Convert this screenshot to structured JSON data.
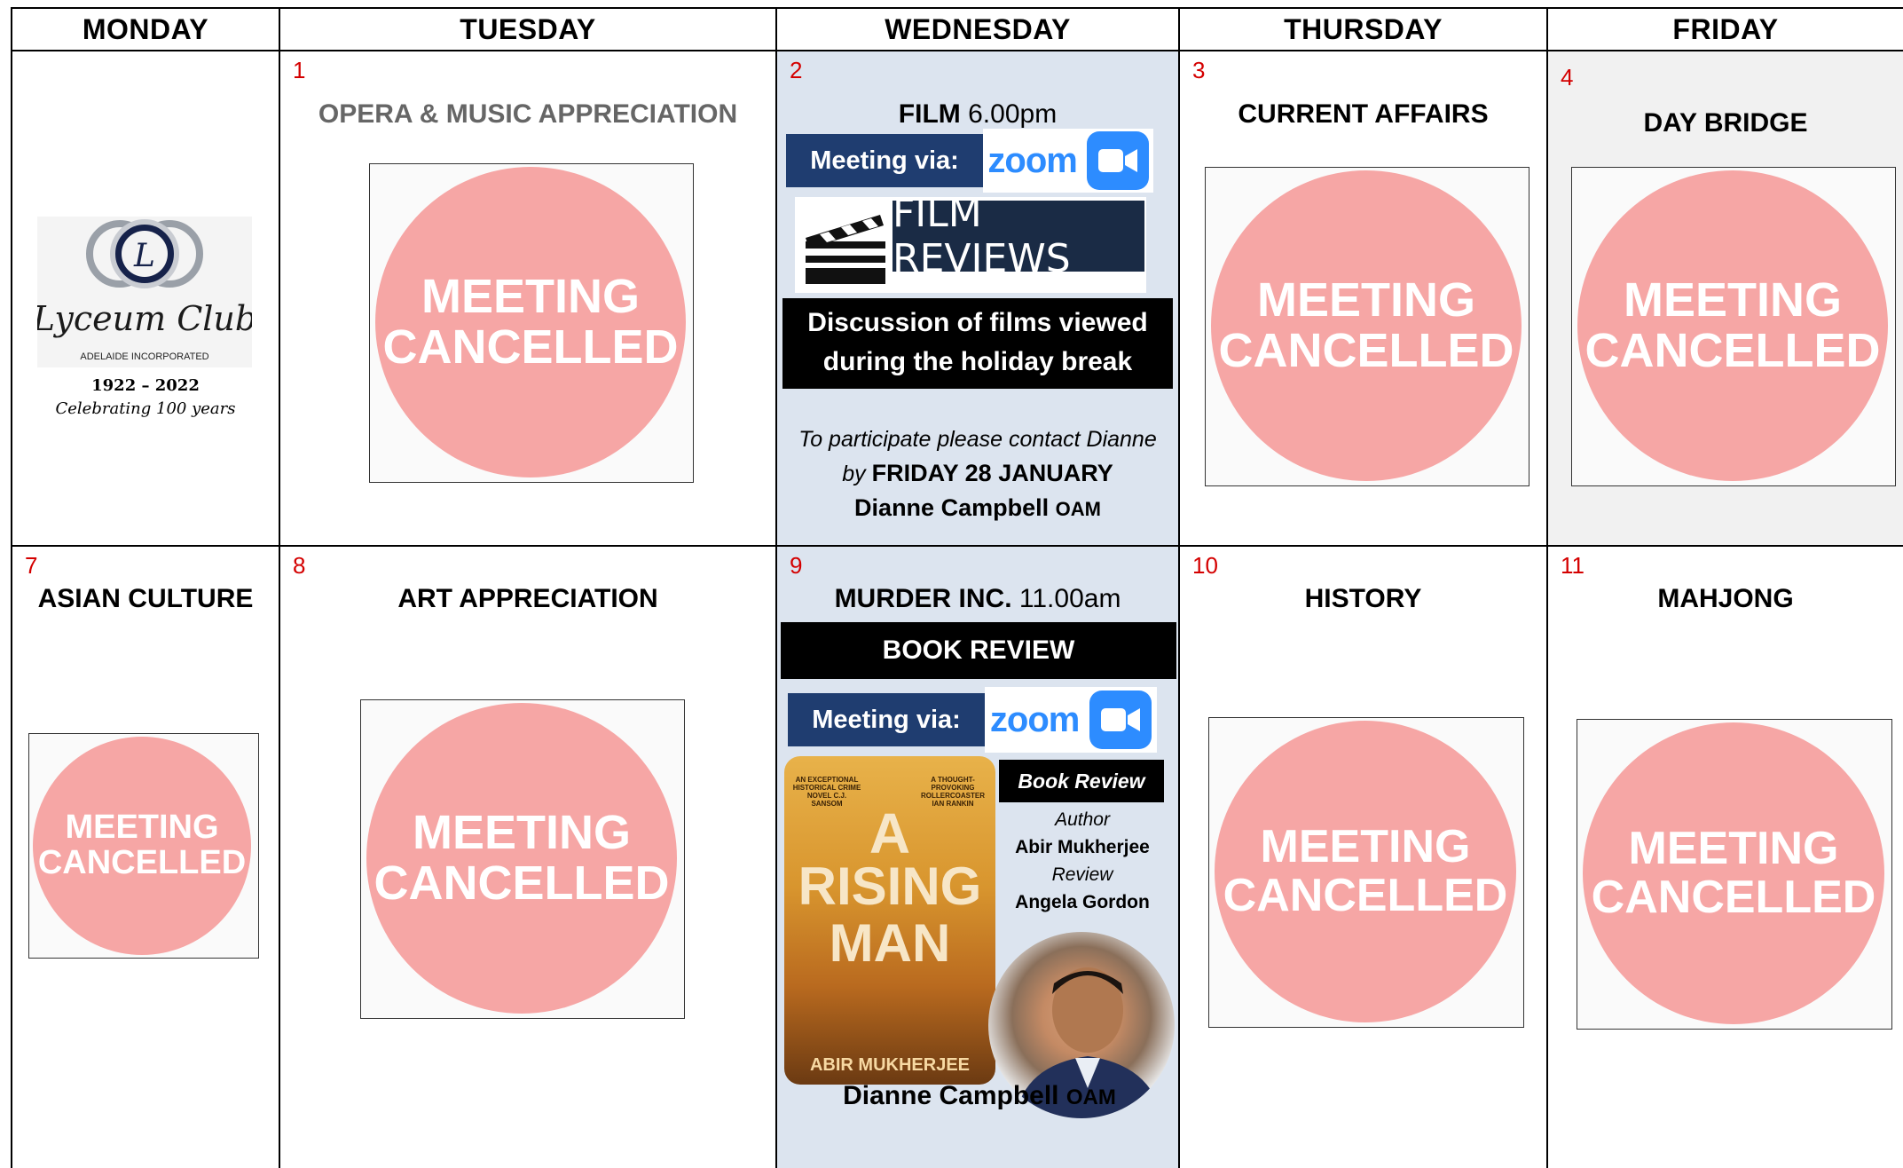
{
  "days": [
    "MONDAY",
    "TUESDAY",
    "WEDNESDAY",
    "THURSDAY",
    "FRIDAY"
  ],
  "cancel": {
    "line1": "MEETING",
    "line2": "CANCELLED"
  },
  "logo": {
    "name": "Lyceum Club",
    "initial": "L",
    "sub": "ADELAIDE INCORPORATED",
    "years": "1922 – 2022",
    "tagline": "Celebrating 100 years"
  },
  "week1": {
    "tue": {
      "num": "1",
      "title": "OPERA & MUSIC APPRECIATION"
    },
    "wed": {
      "num": "2",
      "title": "FILM",
      "time": "6.00pm",
      "meeting_via": "Meeting via:",
      "zoom": "zoom",
      "banner": "FILM REVIEWS",
      "discussion_1": "Discussion of films viewed",
      "discussion_2": "during the holiday break",
      "note_1": "To participate please contact Dianne",
      "note_by": "by",
      "note_date": "FRIDAY 28 JANUARY",
      "contact": "Dianne Campbell",
      "contact_suffix": "OAM"
    },
    "thu": {
      "num": "3",
      "title": "CURRENT AFFAIRS"
    },
    "fri": {
      "num": "4",
      "title": "DAY BRIDGE"
    }
  },
  "week2": {
    "mon": {
      "num": "7",
      "title": "ASIAN CULTURE"
    },
    "tue": {
      "num": "8",
      "title": "ART APPRECIATION"
    },
    "wed": {
      "num": "9",
      "title": "MURDER INC.",
      "time": "11.00am",
      "bar": "BOOK REVIEW",
      "meeting_via": "Meeting via:",
      "zoom": "zoom",
      "book_line1": "A",
      "book_line2": "RISING",
      "book_line3": "MAN",
      "book_author": "ABIR MUKHERJEE",
      "book_quote_left": "AN EXCEPTIONAL HISTORICAL CRIME NOVEL C.J. SANSOM",
      "book_quote_right": "A THOUGHT-PROVOKING ROLLERCOASTER IAN RANKIN",
      "br_label": "Book Review",
      "author_label": "Author",
      "author_name": "Abir Mukherjee",
      "review_label": "Review",
      "reviewer": "Angela Gordon",
      "contact": "Dianne Campbell",
      "contact_suffix": "OAM"
    },
    "thu": {
      "num": "10",
      "title": "HISTORY"
    },
    "fri": {
      "num": "11",
      "title": "MAHJONG"
    }
  }
}
